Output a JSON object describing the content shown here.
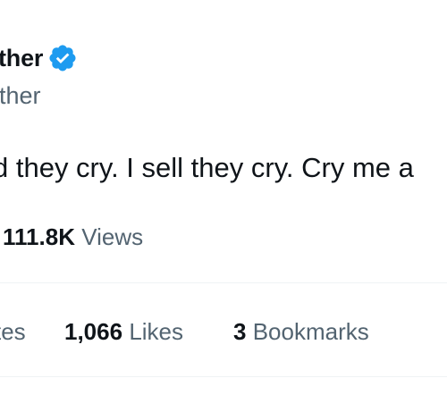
{
  "author": {
    "display_name_visible": "ther",
    "handle_visible": "ther",
    "verified_icon": "verified-badge-icon",
    "verified_color": "#1d9bf0"
  },
  "tweet": {
    "text_visible": "d they cry. I sell they cry. Cry me a"
  },
  "views": {
    "count": "111.8K",
    "label": "Views"
  },
  "stats": {
    "reposts_label_visible": "tes",
    "likes_count": "1,066",
    "likes_label": "Likes",
    "bookmarks_count": "3",
    "bookmarks_label": "Bookmarks"
  },
  "colors": {
    "primary_text": "#0f1419",
    "secondary_text": "#536471",
    "divider": "#eff3f4"
  }
}
